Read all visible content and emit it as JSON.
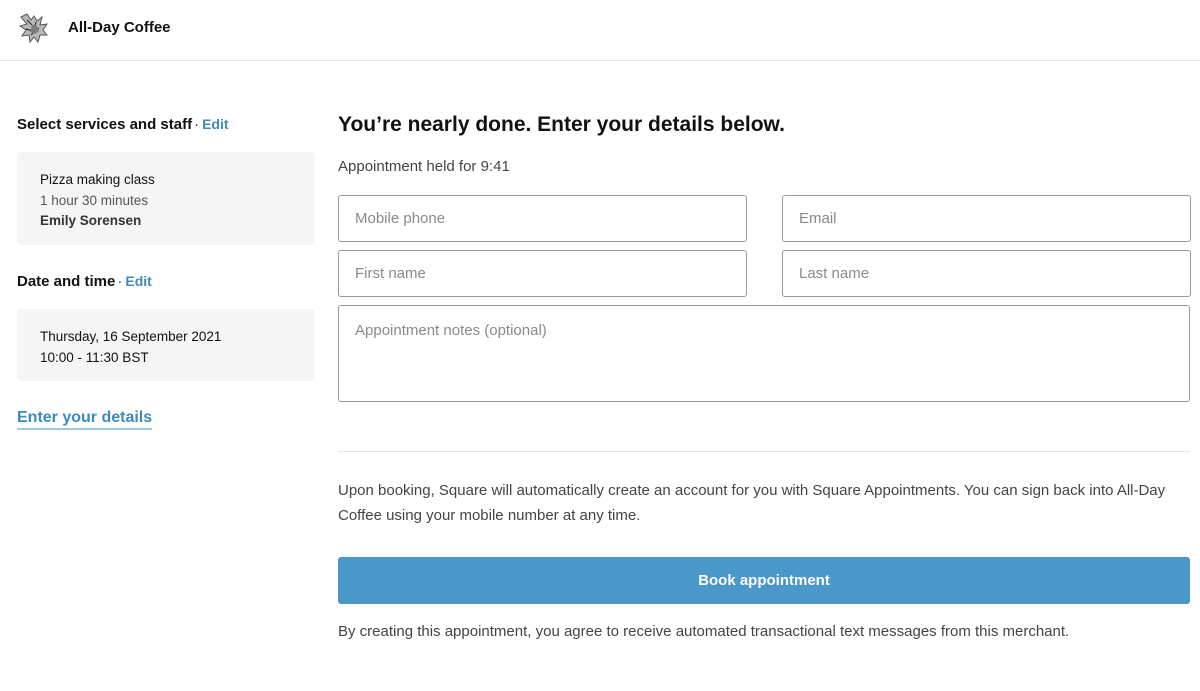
{
  "header": {
    "brand_name": "All-Day Coffee",
    "logo_icon": "bird-illustration-logo"
  },
  "sidebar": {
    "services_heading": "Select services and staff",
    "services_edit": "Edit",
    "service": {
      "name": "Pizza making class",
      "duration": "1 hour 30 minutes",
      "staff": "Emily Sorensen"
    },
    "datetime_heading": "Date and time",
    "datetime_edit": "Edit",
    "datetime": {
      "date": "Thursday, 16 September 2021",
      "time": "10:00 - 11:30 BST"
    },
    "current_step": "Enter your details",
    "separator": "·"
  },
  "main": {
    "title": "You’re nearly done. Enter your details below.",
    "held_text": "Appointment held for 9:41",
    "fields": {
      "mobile_placeholder": "Mobile phone",
      "email_placeholder": "Email",
      "first_name_placeholder": "First name",
      "last_name_placeholder": "Last name",
      "notes_placeholder": "Appointment notes (optional)"
    },
    "info_text": "Upon booking, Square will automatically create an account for you with Square Appointments. You can sign back into All-Day Coffee using your mobile number at any time.",
    "book_button": "Book appointment",
    "consent_text": "By creating this appointment, you agree to receive automated transactional text messages from this merchant."
  },
  "colors": {
    "accent": "#4a97c9",
    "link": "#3d8bbd",
    "card_bg": "#f5f5f5"
  }
}
